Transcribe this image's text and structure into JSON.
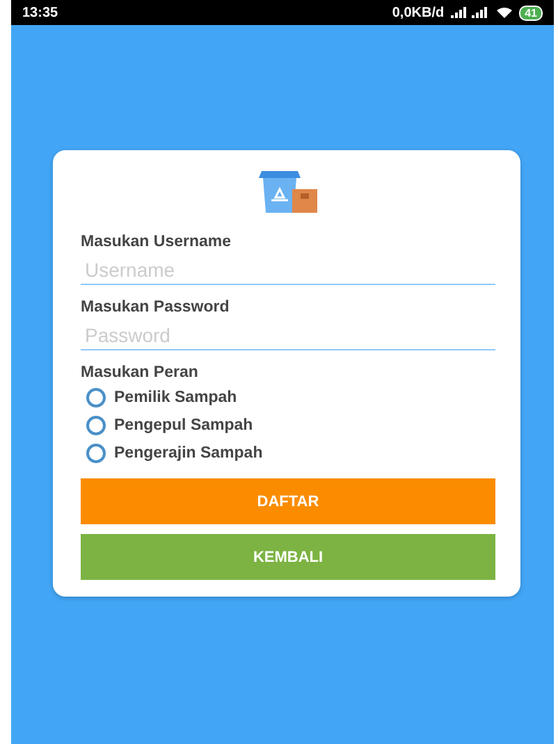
{
  "status_bar": {
    "time": "13:35",
    "data_rate": "0,0KB/d",
    "battery": "41"
  },
  "form": {
    "fields": [
      {
        "label": "Masukan Username",
        "placeholder": "Username"
      },
      {
        "label": "Masukan Password",
        "placeholder": "Password"
      }
    ],
    "role": {
      "label": "Masukan Peran",
      "options": [
        {
          "label": "Pemilik Sampah",
          "selected": false
        },
        {
          "label": "Pengepul Sampah",
          "selected": false
        },
        {
          "label": "Pengerajin Sampah",
          "selected": false
        }
      ]
    },
    "buttons": [
      {
        "label": "DAFTAR",
        "kind": "primary"
      },
      {
        "label": "KEMBALI",
        "kind": "secondary"
      }
    ]
  }
}
